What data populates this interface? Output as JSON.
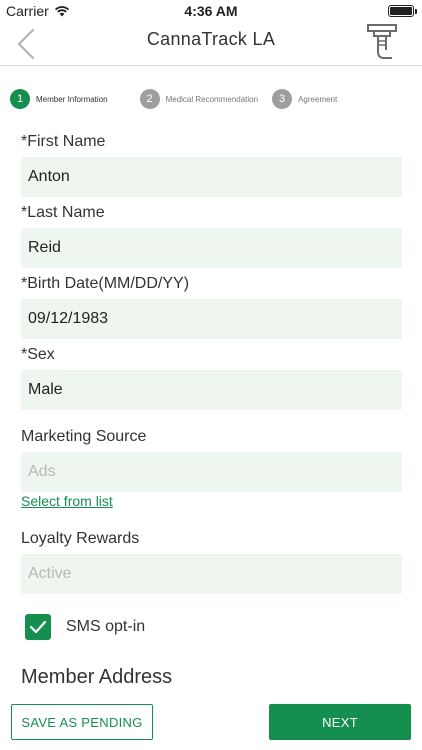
{
  "status_bar": {
    "carrier": "Carrier",
    "time": "4:36 AM",
    "wifi_icon": "wifi-icon",
    "battery_icon": "battery-icon"
  },
  "nav": {
    "title": "CannaTrack LA",
    "back_icon": "chevron-left-icon",
    "scanner_icon": "barcode-scanner-icon"
  },
  "stepper": [
    {
      "number": "1",
      "label": "Member Information",
      "active": true
    },
    {
      "number": "2",
      "label": "Medical Recommendation",
      "active": false
    },
    {
      "number": "3",
      "label": "Agreement",
      "active": false
    }
  ],
  "form": {
    "first_name": {
      "label": "*First Name",
      "value": "Anton"
    },
    "last_name": {
      "label": "*Last Name",
      "value": "Reid"
    },
    "birth_date": {
      "label": "*Birth Date(MM/DD/YY)",
      "value": "09/12/1983"
    },
    "sex": {
      "label": "*Sex",
      "value": "Male"
    },
    "marketing_source": {
      "label": "Marketing Source",
      "placeholder": "Ads",
      "link": "Select from list"
    },
    "loyalty_rewards": {
      "label": "Loyalty Rewards",
      "placeholder": "Active"
    },
    "sms_opt_in": {
      "label": "SMS opt-in",
      "checked": true
    }
  },
  "section": {
    "member_address": "Member Address"
  },
  "buttons": {
    "save_pending": "SAVE AS PENDING",
    "next": "NEXT"
  },
  "colors": {
    "accent": "#158f4f",
    "input_bg": "#eef6ef",
    "inactive_step": "#9e9e9e"
  }
}
